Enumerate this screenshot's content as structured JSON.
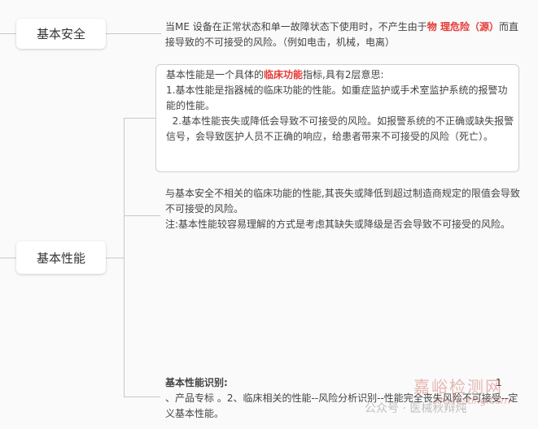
{
  "nodes": {
    "safety": "基本安全",
    "performance": "基本性能"
  },
  "safety_text": {
    "part1": "当ME 设备在正常状态和单一故障状态下使用时，不产生由于",
    "highlight": "物 理危险（源）",
    "part2": "而直接导致的不可接受的风险。（例如电击，机械，电离）"
  },
  "basic_box": {
    "line1_pre": "基本性能是一个具体的",
    "line1_highlight": "临床功能",
    "line1_post": "指标,具有2层意思:",
    "point1": "1.基本性能是指器械的临床功能的性能。如重症监护或手术室监护系统的报警功能的性能。",
    "point2": "  2.基本性能丧失或降低会导致不可接受的风险。如报警系统的不正确或缺失报警信号，会导致医护人员不正确的响应，给患者带来不可接受的风险（死亡）。"
  },
  "definition": {
    "text": "与基本安全不相关的临床功能的性能,其丧失或降低到超过制造商规定的限值会导致不可接受的风险。",
    "note": "注:基本性能较容易理解的方式是考虑其缺失或降级是否会导致不可接受的风险。"
  },
  "identification": {
    "title": "基本性能识别:",
    "num": "1",
    "text": "、产品专标 。2、临床相关的性能--风险分析识别--性能完全丧失风险不可接受--定义基本性能。"
  },
  "watermark": {
    "brand": "嘉峪检测网",
    "url": "AnyTesting.com",
    "account": "公众号 · 医械秋辩炖"
  }
}
